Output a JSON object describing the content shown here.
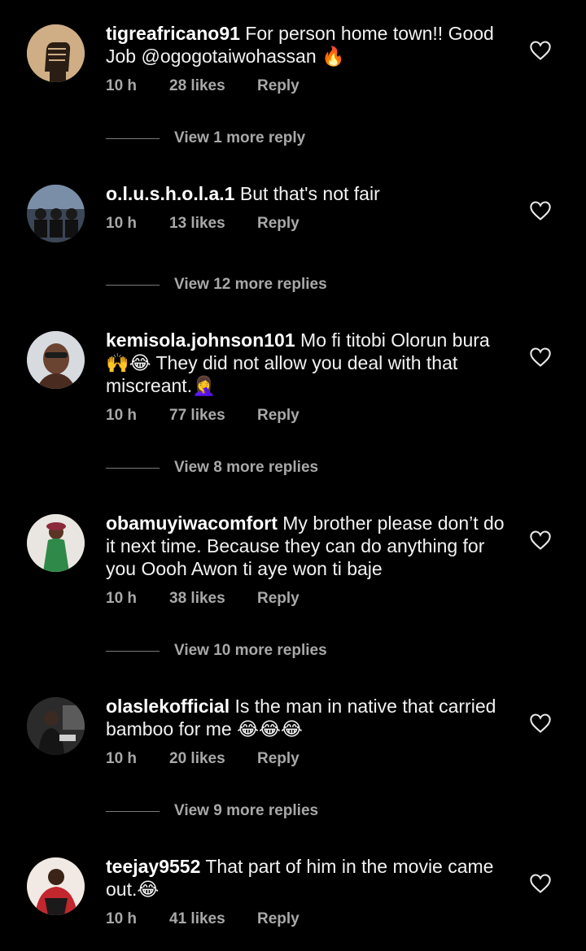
{
  "comments": [
    {
      "username": "tigreafricano91",
      "text": "For person home town!! Good Job @ogogotaiwohassan 🔥",
      "time": "10 h",
      "likes": "28 likes",
      "reply": "Reply",
      "view_replies": "View 1 more reply"
    },
    {
      "username": "o.l.u.s.h.o.l.a.1",
      "text": "But that's not fair",
      "time": "10 h",
      "likes": "13 likes",
      "reply": "Reply",
      "view_replies": "View 12 more replies"
    },
    {
      "username": "kemisola.johnson101",
      "text": "Mo fi titobi Olorun bura 🙌😂 They did not allow you deal with that miscreant.🤦‍♀️",
      "time": "10 h",
      "likes": "77 likes",
      "reply": "Reply",
      "view_replies": "View 8 more replies"
    },
    {
      "username": "obamuyiwacomfort",
      "text": "My brother please don’t do it next time. Because they can do anything for you Oooh Awon ti aye won ti baje",
      "time": "10 h",
      "likes": "38 likes",
      "reply": "Reply",
      "view_replies": "View 10 more replies"
    },
    {
      "username": "olaslekofficial",
      "text": "Is the man in native that carried bamboo for me 😂😂😂",
      "time": "10 h",
      "likes": "20 likes",
      "reply": "Reply",
      "view_replies": "View 9 more replies"
    },
    {
      "username": "teejay9552",
      "text": "That part of him in the movie came out.😂",
      "time": "10 h",
      "likes": "41 likes",
      "reply": "Reply"
    }
  ]
}
